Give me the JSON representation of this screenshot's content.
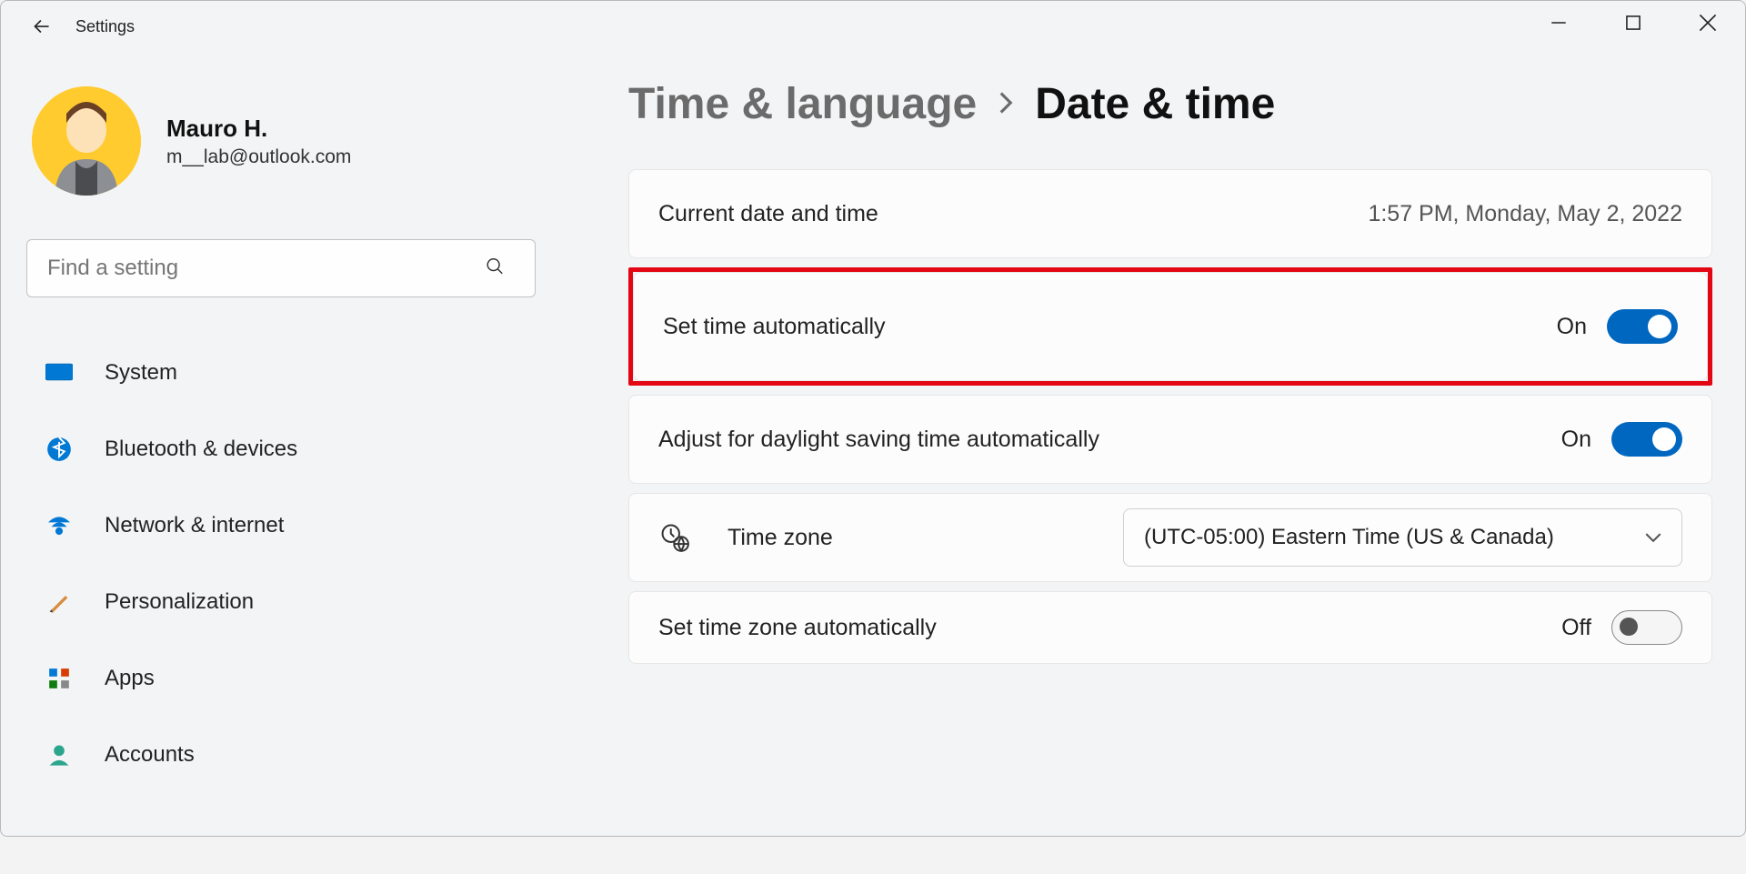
{
  "titlebar": {
    "app_title": "Settings"
  },
  "profile": {
    "name": "Mauro H.",
    "email": "m__lab@outlook.com"
  },
  "search": {
    "placeholder": "Find a setting"
  },
  "sidebar": {
    "items": [
      {
        "label": "System"
      },
      {
        "label": "Bluetooth & devices"
      },
      {
        "label": "Network & internet"
      },
      {
        "label": "Personalization"
      },
      {
        "label": "Apps"
      },
      {
        "label": "Accounts"
      }
    ]
  },
  "breadcrumb": {
    "parent": "Time & language",
    "current": "Date & time"
  },
  "current_dt": {
    "label": "Current date and time",
    "value": "1:57 PM, Monday, May 2, 2022"
  },
  "set_time_auto": {
    "label": "Set time automatically",
    "state": "On"
  },
  "dst_auto": {
    "label": "Adjust for daylight saving time automatically",
    "state": "On"
  },
  "timezone": {
    "label": "Time zone",
    "selected": "(UTC-05:00) Eastern Time (US & Canada)"
  },
  "tz_auto": {
    "label": "Set time zone automatically",
    "state": "Off"
  }
}
